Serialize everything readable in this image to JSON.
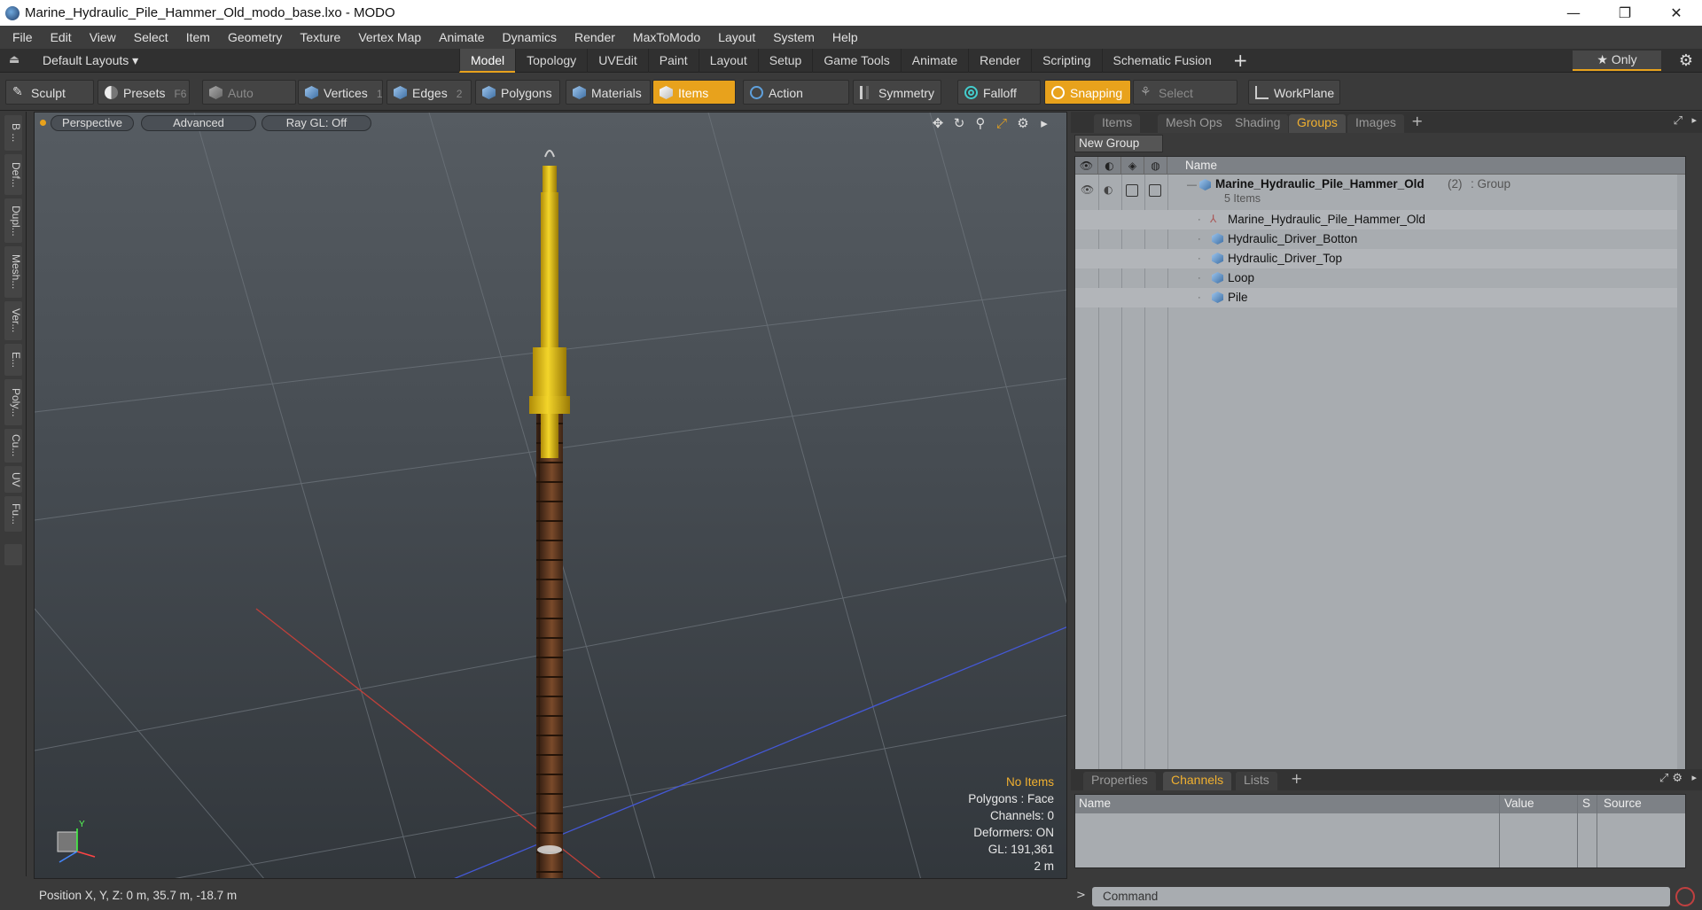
{
  "window": {
    "title": "Marine_Hydraulic_Pile_Hammer_Old_modo_base.lxo - MODO",
    "minimize": "—",
    "restore": "❐",
    "close": "✕"
  },
  "menu": [
    "File",
    "Edit",
    "View",
    "Select",
    "Item",
    "Geometry",
    "Texture",
    "Vertex Map",
    "Animate",
    "Dynamics",
    "Render",
    "MaxToModo",
    "Layout",
    "System",
    "Help"
  ],
  "layoutbar": {
    "layouts_label": "Default Layouts ▾",
    "tabs": [
      "Model",
      "Topology",
      "UVEdit",
      "Paint",
      "Layout",
      "Setup",
      "Game Tools",
      "Animate",
      "Render",
      "Scripting",
      "Schematic Fusion"
    ],
    "active_tab": "Model",
    "add": "+",
    "only_label": "★  Only"
  },
  "toolbar": {
    "sculpt": "Sculpt",
    "presets": "Presets",
    "presets_key": "F6",
    "auto_select": "Auto Select",
    "vertices": "Vertices",
    "vertices_num": "1",
    "edges": "Edges",
    "edges_num": "2",
    "polygons": "Polygons",
    "materials": "Materials",
    "items": "Items",
    "action_center": "Action Center",
    "symmetry": "Symmetry",
    "falloff": "Falloff",
    "snapping": "Snapping",
    "select_through": "Select Through",
    "workplane": "WorkPlane"
  },
  "leftstrip": [
    "B ...",
    "Def...",
    "Dupl...",
    "Mesh...",
    "Ver...",
    "E...",
    "Poly...",
    "Cu...",
    "UV",
    "Fu..."
  ],
  "viewport": {
    "view_mode": "Perspective",
    "shading": "Advanced",
    "raygl": "Ray GL: Off",
    "info": {
      "no_items": "No Items",
      "polygons": "Polygons : Face",
      "channels": "Channels: 0",
      "deformers": "Deformers: ON",
      "gl": "GL: 191,361",
      "scale": "2 m"
    },
    "axis_y": "Y"
  },
  "status": {
    "position": "Position X, Y, Z:   0 m, 35.7 m, -18.7 m"
  },
  "rightpanel": {
    "top_tabs": [
      "Items",
      "Mesh Ops",
      "Shading",
      "Groups",
      "Images"
    ],
    "active_top_tab": "Groups",
    "new_group": "New Group",
    "name_header": "Name",
    "group": {
      "name": "Marine_Hydraulic_Pile_Hammer_Old",
      "count": "(2)",
      "type": ": Group",
      "sub": "5 Items"
    },
    "children": [
      {
        "name": "Marine_Hydraulic_Pile_Hammer_Old",
        "icon": "locator-icon"
      },
      {
        "name": "Hydraulic_Driver_Botton",
        "icon": "mesh-icon"
      },
      {
        "name": "Hydraulic_Driver_Top",
        "icon": "mesh-icon"
      },
      {
        "name": "Loop",
        "icon": "mesh-icon"
      },
      {
        "name": "Pile",
        "icon": "mesh-icon"
      }
    ],
    "bottom_tabs": [
      "Properties",
      "Channels",
      "Lists"
    ],
    "active_bottom_tab": "Channels",
    "channel_headers": {
      "name": "Name",
      "value": "Value",
      "s": "S",
      "source": "Source"
    },
    "command_placeholder": "Command"
  },
  "colors": {
    "accent": "#e8a21c",
    "hammer_yellow": "#e3c21a",
    "pile_brown": "#5a3520"
  }
}
